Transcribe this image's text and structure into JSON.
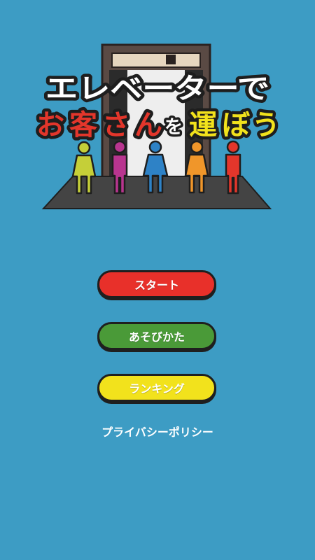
{
  "title": {
    "line1": "エレベーターで",
    "line2": [
      "お",
      "客",
      "さ",
      "ん",
      "を",
      "運",
      "ぼ",
      "う"
    ]
  },
  "colors": {
    "background": "#3d9cc4",
    "start": "#e8302a",
    "howto": "#4a9a38",
    "ranking": "#f2e21c",
    "person_yellow": "#c5cf38",
    "person_magenta": "#b8358f",
    "person_blue": "#2e82c6",
    "person_orange": "#f0962a",
    "person_red": "#e3362b"
  },
  "menu": {
    "start_label": "スタート",
    "howto_label": "あそびかた",
    "ranking_label": "ランキング"
  },
  "footer": {
    "privacy_label": "プライバシーポリシー"
  }
}
